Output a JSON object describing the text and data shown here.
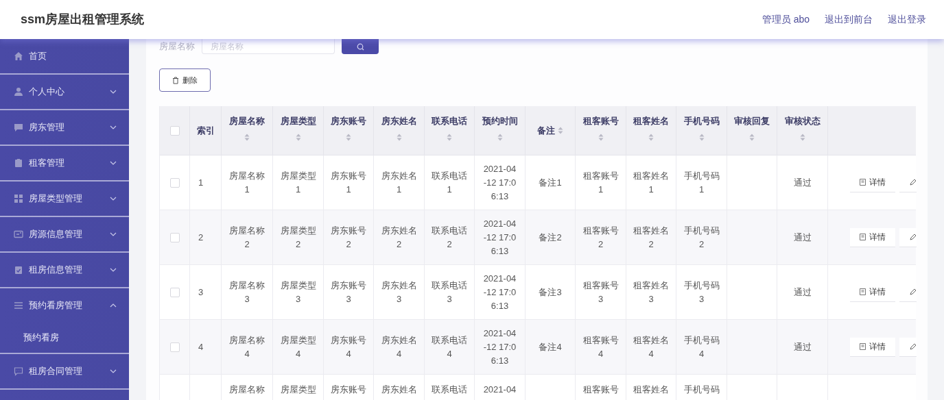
{
  "header": {
    "title": "ssm房屋出租管理系统",
    "user": "管理员 abo",
    "links": [
      "退出到前台",
      "退出登录"
    ]
  },
  "sidebar": {
    "items": [
      {
        "label": "首页",
        "kind": "link"
      },
      {
        "label": "个人中心",
        "kind": "menu",
        "expanded": false
      },
      {
        "label": "房东管理",
        "kind": "menu",
        "expanded": false
      },
      {
        "label": "租客管理",
        "kind": "menu",
        "expanded": false
      },
      {
        "label": "房屋类型管理",
        "kind": "menu",
        "expanded": false
      },
      {
        "label": "房源信息管理",
        "kind": "menu",
        "expanded": false
      },
      {
        "label": "租房信息管理",
        "kind": "menu",
        "expanded": false
      },
      {
        "label": "预约看房管理",
        "kind": "menu",
        "expanded": true,
        "children": [
          {
            "label": "预约看房"
          }
        ]
      },
      {
        "label": "租房合同管理",
        "kind": "menu",
        "expanded": false
      }
    ]
  },
  "search": {
    "label": "房屋名称",
    "placeholder": "房屋名称"
  },
  "delete_button": {
    "label": "删除"
  },
  "table": {
    "select_all": {
      "checked": false
    },
    "columns": [
      {
        "label": "索引",
        "sortable": false
      },
      {
        "label": "房屋名称",
        "sortable": true
      },
      {
        "label": "房屋类型",
        "sortable": true
      },
      {
        "label": "房东账号",
        "sortable": true
      },
      {
        "label": "房东姓名",
        "sortable": true
      },
      {
        "label": "联系电话",
        "sortable": true
      },
      {
        "label": "预约时间",
        "sortable": true
      },
      {
        "label": "备注",
        "sortable": true
      },
      {
        "label": "租客账号",
        "sortable": true
      },
      {
        "label": "租客姓名",
        "sortable": true
      },
      {
        "label": "手机号码",
        "sortable": true
      },
      {
        "label": "审核回复",
        "sortable": true
      },
      {
        "label": "审核状态",
        "sortable": true
      }
    ],
    "rows": [
      {
        "checked": false,
        "cells": [
          "1",
          "房屋名称1",
          "房屋类型1",
          "房东账号1",
          "房东姓名1",
          "联系电话1",
          "2021-04-12 17:06:13",
          "备注1",
          "租客账号1",
          "租客姓名1",
          "手机号码1",
          "",
          "通过"
        ],
        "actions": [
          "详情"
        ]
      },
      {
        "checked": false,
        "cells": [
          "2",
          "房屋名称2",
          "房屋类型2",
          "房东账号2",
          "房东姓名2",
          "联系电话2",
          "2021-04-12 17:06:13",
          "备注2",
          "租客账号2",
          "租客姓名2",
          "手机号码2",
          "",
          "通过"
        ],
        "actions": [
          "详情"
        ]
      },
      {
        "checked": false,
        "cells": [
          "3",
          "房屋名称3",
          "房屋类型3",
          "房东账号3",
          "房东姓名3",
          "联系电话3",
          "2021-04-12 17:06:13",
          "备注3",
          "租客账号3",
          "租客姓名3",
          "手机号码3",
          "",
          "通过"
        ],
        "actions": [
          "详情"
        ]
      },
      {
        "checked": false,
        "cells": [
          "4",
          "房屋名称4",
          "房屋类型4",
          "房东账号4",
          "房东姓名4",
          "联系电话4",
          "2021-04-12 17:06:13",
          "备注4",
          "租客账号4",
          "租客姓名4",
          "手机号码4",
          "",
          "通过"
        ],
        "actions": [
          "详情"
        ]
      }
    ],
    "partial_row": {
      "cells": [
        "",
        "房屋名称",
        "房屋类型",
        "房东账号",
        "房东姓名",
        "联系电话",
        "2021-04",
        "",
        "租客账号",
        "租客姓名",
        "手机号码",
        "",
        ""
      ]
    }
  }
}
